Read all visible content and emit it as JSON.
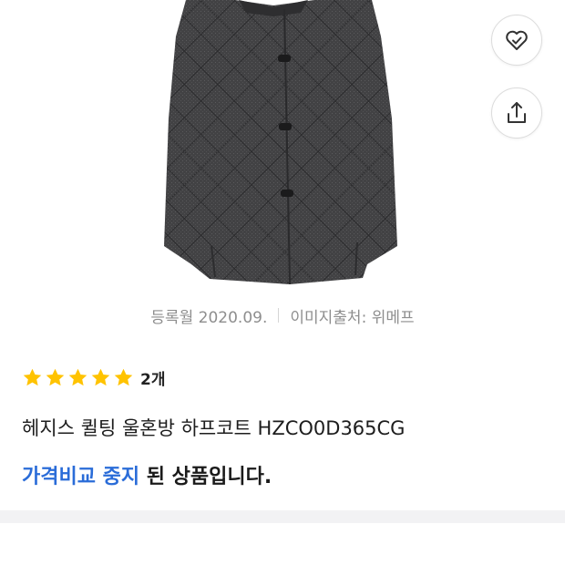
{
  "product": {
    "image_alt": "herringbone quilted half coat",
    "registered": "등록월 2020.09.",
    "image_source": "이미지출처: 위메프",
    "rating": 5,
    "review_count": "2개",
    "title": "헤지스 퀼팅 울혼방 하프코트 HZCO0D365CG"
  },
  "notice": {
    "highlight": "가격비교 중지",
    "rest": " 된 상품입니다."
  },
  "actions": {
    "wishlist_icon": "heart-check-icon",
    "share_icon": "share-icon"
  },
  "colors": {
    "star": "#ffc300",
    "accent": "#2a6cd8",
    "coat": "#3d3d3f"
  }
}
